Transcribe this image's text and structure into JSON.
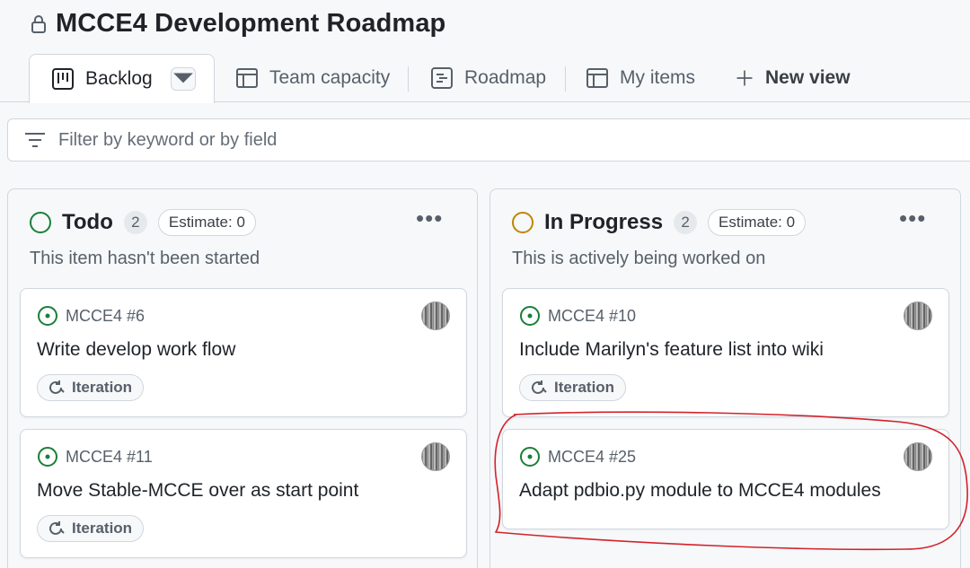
{
  "project": {
    "title": "MCCE4 Development Roadmap"
  },
  "tabs": [
    {
      "label": "Backlog",
      "icon": "board-icon",
      "active": true
    },
    {
      "label": "Team capacity",
      "icon": "table-icon"
    },
    {
      "label": "Roadmap",
      "icon": "roadmap-icon"
    },
    {
      "label": "My items",
      "icon": "table-icon"
    },
    {
      "label": "New view",
      "icon": "plus-icon"
    }
  ],
  "filter": {
    "placeholder": "Filter by keyword or by field"
  },
  "columns": [
    {
      "name": "Todo",
      "count": "2",
      "estimate": "Estimate: 0",
      "description": "This item hasn't been started",
      "status_color": "#1a7f37",
      "cards": [
        {
          "ref": "MCCE4 #6",
          "title": "Write develop work flow",
          "field": "Iteration"
        },
        {
          "ref": "MCCE4 #11",
          "title": "Move Stable-MCCE over as start point",
          "field": "Iteration"
        }
      ]
    },
    {
      "name": "In Progress",
      "count": "2",
      "estimate": "Estimate: 0",
      "description": "This is actively being worked on",
      "status_color": "#bf8700",
      "cards": [
        {
          "ref": "MCCE4 #10",
          "title": "Include Marilyn's feature list into wiki",
          "field": "Iteration"
        },
        {
          "ref": "MCCE4 #25",
          "title": "Adapt pdbio.py module to MCCE4 modules"
        }
      ]
    }
  ],
  "colors": {
    "open_issue": "#1a7f37",
    "annotation": "#d3222a"
  }
}
